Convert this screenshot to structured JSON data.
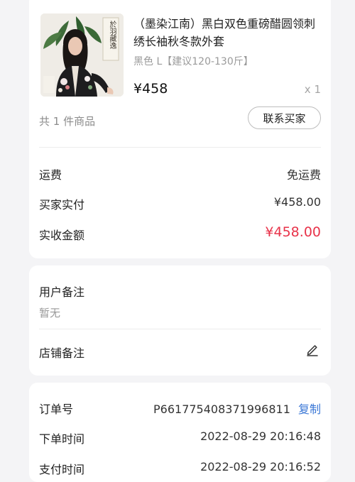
{
  "product": {
    "title": "（墨染江南）黑白双色重磅醋圆领刺绣长袖秋冬款外套",
    "variant": "黑色 L【建议120-130斤】",
    "price": "¥458",
    "quantity": "x 1",
    "item_count": "共 1 件商品",
    "contact_button": "联系买家",
    "thumb_seal_text": "於羽藏逸"
  },
  "fees": {
    "shipping_label": "运费",
    "shipping_value": "免运费",
    "buyer_paid_label": "买家实付",
    "buyer_paid_value": "¥458.00",
    "received_label": "实收金额",
    "received_value": "¥458.00"
  },
  "notes": {
    "user_note_label": "用户备注",
    "user_note_value": "暂无",
    "shop_note_label": "店铺备注"
  },
  "order": {
    "order_no_label": "订单号",
    "order_no_value": "P661775408371996811",
    "copy_label": "复制",
    "created_label": "下单时间",
    "created_value": "2022-08-29 20:16:48",
    "paid_label": "支付时间",
    "paid_value": "2022-08-29 20:16:52"
  },
  "colors": {
    "accent_red": "#e8334a",
    "link_blue": "#3a77d6"
  }
}
